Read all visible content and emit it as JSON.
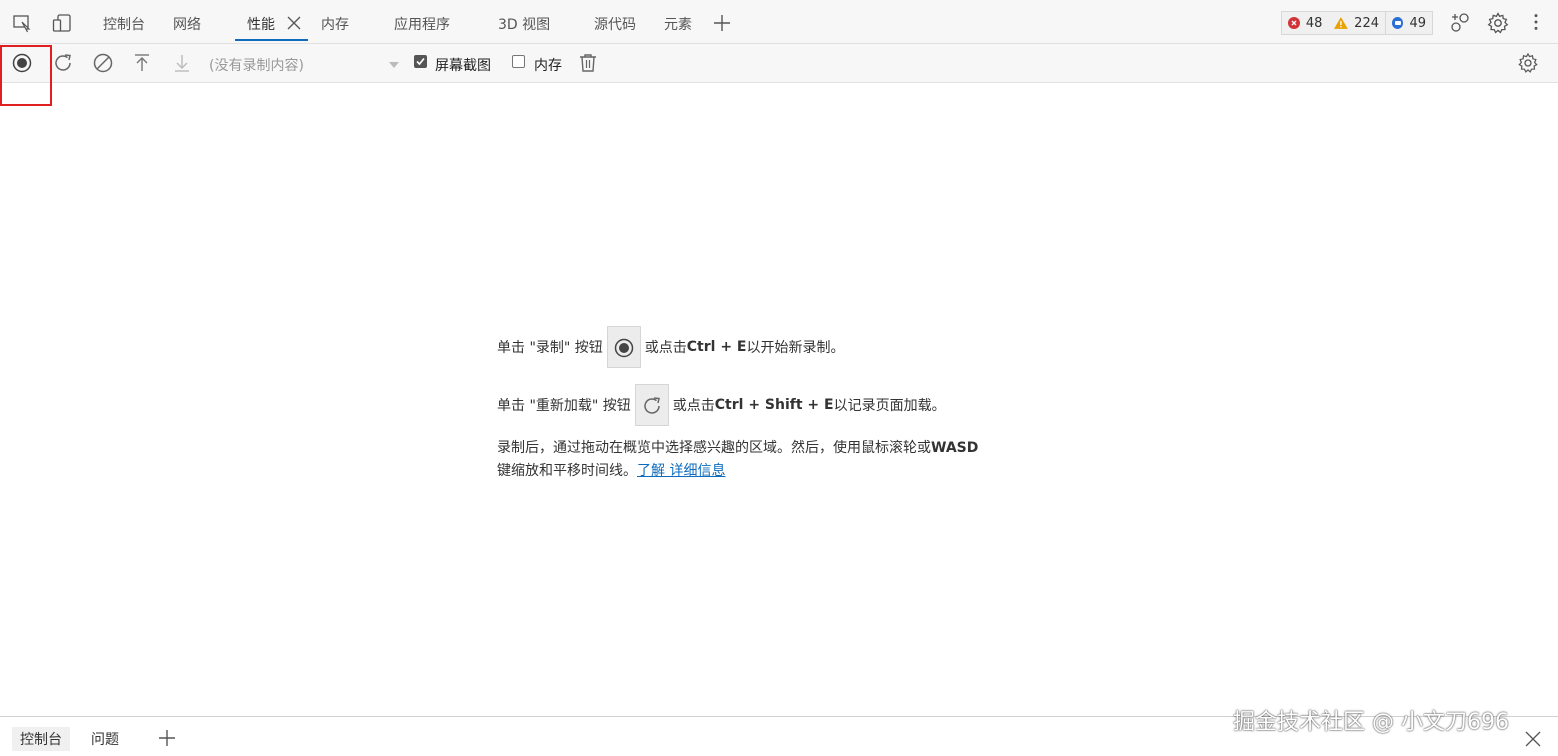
{
  "tabs": [
    {
      "label": "控制台"
    },
    {
      "label": "网络"
    },
    {
      "label": "性能"
    },
    {
      "label": "内存"
    },
    {
      "label": "应用程序"
    },
    {
      "label": "3D 视图"
    },
    {
      "label": "源代码"
    },
    {
      "label": "元素"
    }
  ],
  "badges": {
    "errors": "48",
    "warnings": "224",
    "info": "49"
  },
  "toolbar": {
    "recording_select": "(没有录制内容)",
    "screenshot_label": "屏幕截图",
    "memory_label": "内存"
  },
  "landing": {
    "line1_pre": "单击 \"录制\" 按钮",
    "line1_post_a": "或点击",
    "line1_shortcut": "Ctrl + E",
    "line1_post_b": " 以开始新录制。",
    "line2_pre": "单击 \"重新加载\" 按钮",
    "line2_post_a": "或点击",
    "line2_shortcut": "Ctrl + Shift + E",
    "line2_post_b": " 以记录页面加载。",
    "para_a": "录制后，通过拖动在概览中选择感兴趣的区域。然后，使用鼠标滚轮或",
    "para_keys": "WASD",
    "para_b": "键缩放和平移时间线。",
    "link_text": "了解   详细信息"
  },
  "drawer": {
    "tab_console": "控制台",
    "tab_issues": "问题"
  },
  "watermark": "掘金技术社区 @ 小文刀696",
  "colors": {
    "accent": "#0f6cbd",
    "error": "#d13438",
    "warning": "#e8a100",
    "info": "#2b6fd6",
    "highlight": "#e02020"
  }
}
